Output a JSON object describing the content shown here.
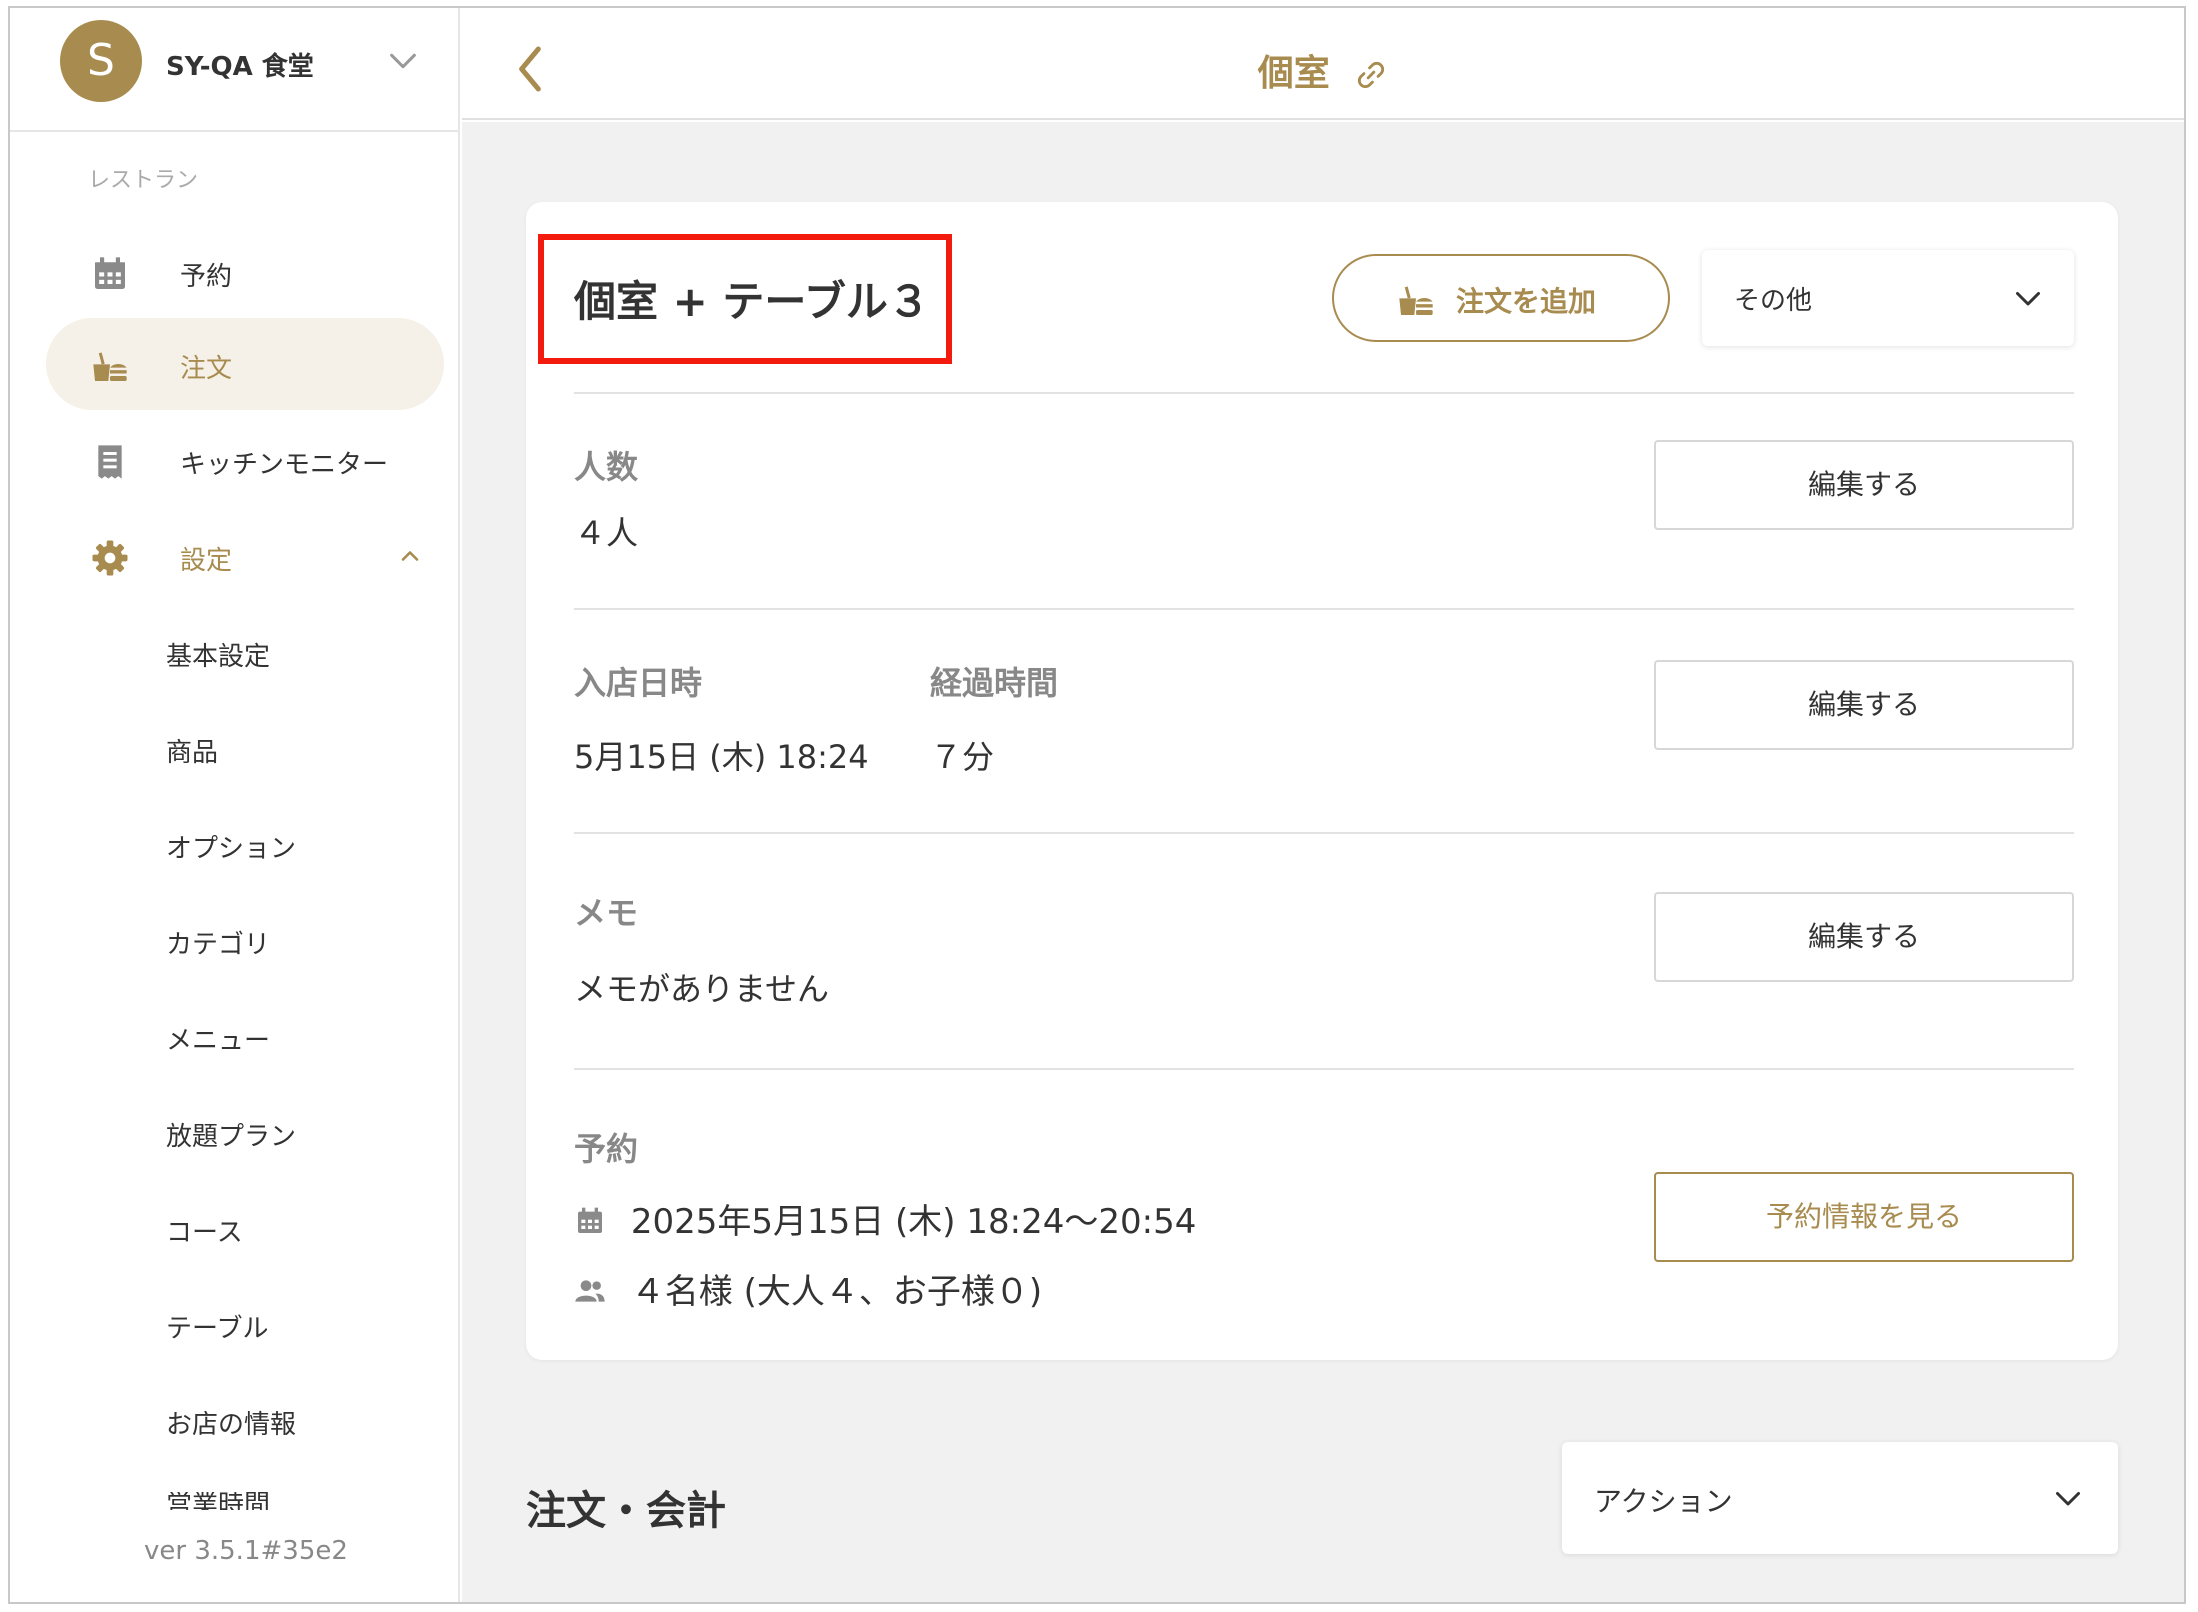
{
  "colors": {
    "accent": "#a88b4e",
    "highlight": "#f31b0d",
    "active_bg": "#f5f1e8"
  },
  "shop": {
    "avatar_letter": "S",
    "name": "SY-QA 食堂"
  },
  "sidebar": {
    "section_label": "レストラン",
    "items": [
      {
        "label": "予約",
        "icon": "calendar-icon"
      },
      {
        "label": "注文",
        "icon": "order-icon",
        "active": true
      },
      {
        "label": "キッチンモニター",
        "icon": "receipt-icon"
      },
      {
        "label": "設定",
        "icon": "gear-icon",
        "expanded": true
      }
    ],
    "subitems": [
      "基本設定",
      "商品",
      "オプション",
      "カテゴリ",
      "メニュー",
      "放題プラン",
      "コース",
      "テーブル",
      "お店の情報",
      "営業時間"
    ],
    "version": "ver 3.5.1#35e2"
  },
  "header": {
    "title": "個室"
  },
  "card": {
    "table_name": "個室 + テーブル３",
    "add_order_label": "注文を追加",
    "other_select": "その他",
    "guests": {
      "label": "人数",
      "value": "４人",
      "edit": "編集する"
    },
    "entry": {
      "label": "入店日時",
      "value": "5月15日 (木) 18:24",
      "elapsed_label": "経過時間",
      "elapsed_value": "７分",
      "edit": "編集する"
    },
    "memo": {
      "label": "メモ",
      "value": "メモがありません",
      "edit": "編集する"
    },
    "reservation": {
      "label": "予約",
      "datetime": "2025年5月15日 (木) 18:24〜20:54",
      "people": "４名様 (大人４、お子様０)",
      "view_button": "予約情報を見る"
    }
  },
  "orders": {
    "title": "注文・会計",
    "action_select": "アクション"
  }
}
